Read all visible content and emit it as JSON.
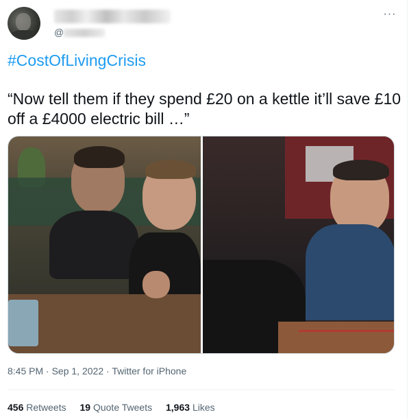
{
  "tweet": {
    "handle_prefix": "@",
    "more_icon": "more-horizontal-icon",
    "hashtag": "#CostOfLivingCrisis",
    "text": "“Now tell them if they spend £20 on a kettle it’ll save £10 off a £4000 electric bill …”",
    "time": "8:45 PM",
    "separator1": " · ",
    "date": "Sep 1, 2022",
    "separator2": " · ",
    "source": "Twitter for iPhone",
    "colors": {
      "link": "#1d9bf0",
      "secondary": "#536471",
      "primary": "#0f1419"
    }
  },
  "stats": {
    "retweets_count": "456",
    "retweets_label": "Retweets",
    "quotes_count": "19",
    "quotes_label": "Quote Tweets",
    "likes_count": "1,963",
    "likes_label": "Likes"
  }
}
